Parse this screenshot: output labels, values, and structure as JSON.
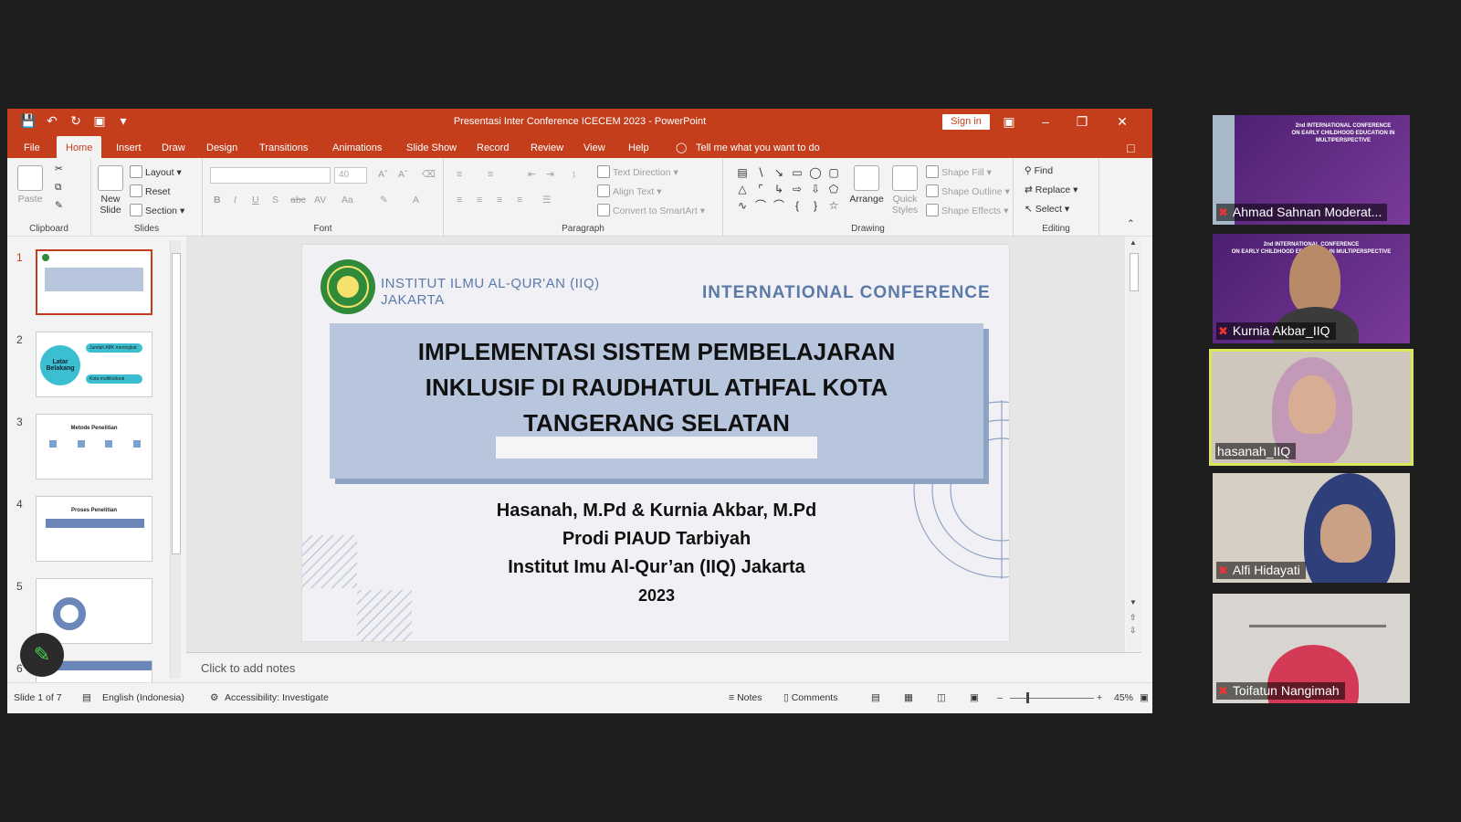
{
  "window": {
    "title": "Presentasi Inter Conference ICECEM 2023  -  PowerPoint",
    "sign_in": "Sign in"
  },
  "menu": {
    "items": [
      "File",
      "Home",
      "Insert",
      "Draw",
      "Design",
      "Transitions",
      "Animations",
      "Slide Show",
      "Record",
      "Review",
      "View",
      "Help"
    ],
    "active": "Home",
    "tell_me": "Tell me what you want to do"
  },
  "ribbon": {
    "clipboard": {
      "label": "Clipboard",
      "paste": "Paste"
    },
    "slides": {
      "label": "Slides",
      "new_slide": "New\nSlide",
      "layout": "Layout",
      "reset": "Reset",
      "section": "Section"
    },
    "font": {
      "label": "Font",
      "size": "40"
    },
    "paragraph": {
      "label": "Paragraph",
      "text_direction": "Text Direction",
      "align_text": "Align Text",
      "convert": "Convert to SmartArt"
    },
    "drawing": {
      "label": "Drawing",
      "arrange": "Arrange",
      "quick_styles": "Quick\nStyles",
      "shape_fill": "Shape Fill",
      "shape_outline": "Shape Outline",
      "shape_effects": "Shape Effects"
    },
    "editing": {
      "label": "Editing",
      "find": "Find",
      "replace": "Replace",
      "select": "Select"
    }
  },
  "thumbnails": [
    "1",
    "2",
    "3",
    "4",
    "5",
    "6"
  ],
  "thumbnail_texts": {
    "t2_a": "Latar Belakang",
    "t2_b": "Jumlah ABK meningkat",
    "t2_c": "Kota multikultural",
    "t3": "Metode Penelitian",
    "t4": "Proses Penelitian"
  },
  "slide": {
    "institute_line1": "INSTITUT ILMU AL-QUR'AN (IIQ)",
    "institute_line2": "JAKARTA",
    "conference": "INTERNATIONAL CONFERENCE",
    "title_line1": "IMPLEMENTASI SISTEM PEMBELAJARAN",
    "title_line2": "INKLUSIF DI RAUDHATUL ATHFAL KOTA",
    "title_line3": "TANGERANG SELATAN",
    "authors": "Hasanah, M.Pd & Kurnia Akbar, M.Pd",
    "prodi": "Prodi PIAUD Tarbiyah",
    "institution": "Institut Imu Al-Qur’an (IIQ) Jakarta",
    "year": "2023"
  },
  "notes_placeholder": "Click to add notes",
  "status": {
    "slide_of": "Slide 1 of 7",
    "language": "English (Indonesia)",
    "accessibility": "Accessibility: Investigate",
    "notes": "Notes",
    "comments": "Comments",
    "zoom": "45%"
  },
  "participants": [
    {
      "name": "Ahmad Sahnan Moderat...",
      "muted": true
    },
    {
      "name": "Kurnia Akbar_IIQ",
      "muted": true
    },
    {
      "name": "hasanah_IIQ",
      "muted": false
    },
    {
      "name": "Alfi Hidayati",
      "muted": true
    },
    {
      "name": "Toifatun Nangimah",
      "muted": true
    }
  ],
  "participant_banner": {
    "line1": "2nd INTERNATIONAL CONFERENCE",
    "line2": "ON EARLY CHILDHOOD EDUCATION IN MULTIPERSPECTIVE"
  },
  "colors": {
    "accent": "#c43e1c",
    "slide_title_bg": "#b7c6dc",
    "active_speaker": "#dbe85a"
  }
}
